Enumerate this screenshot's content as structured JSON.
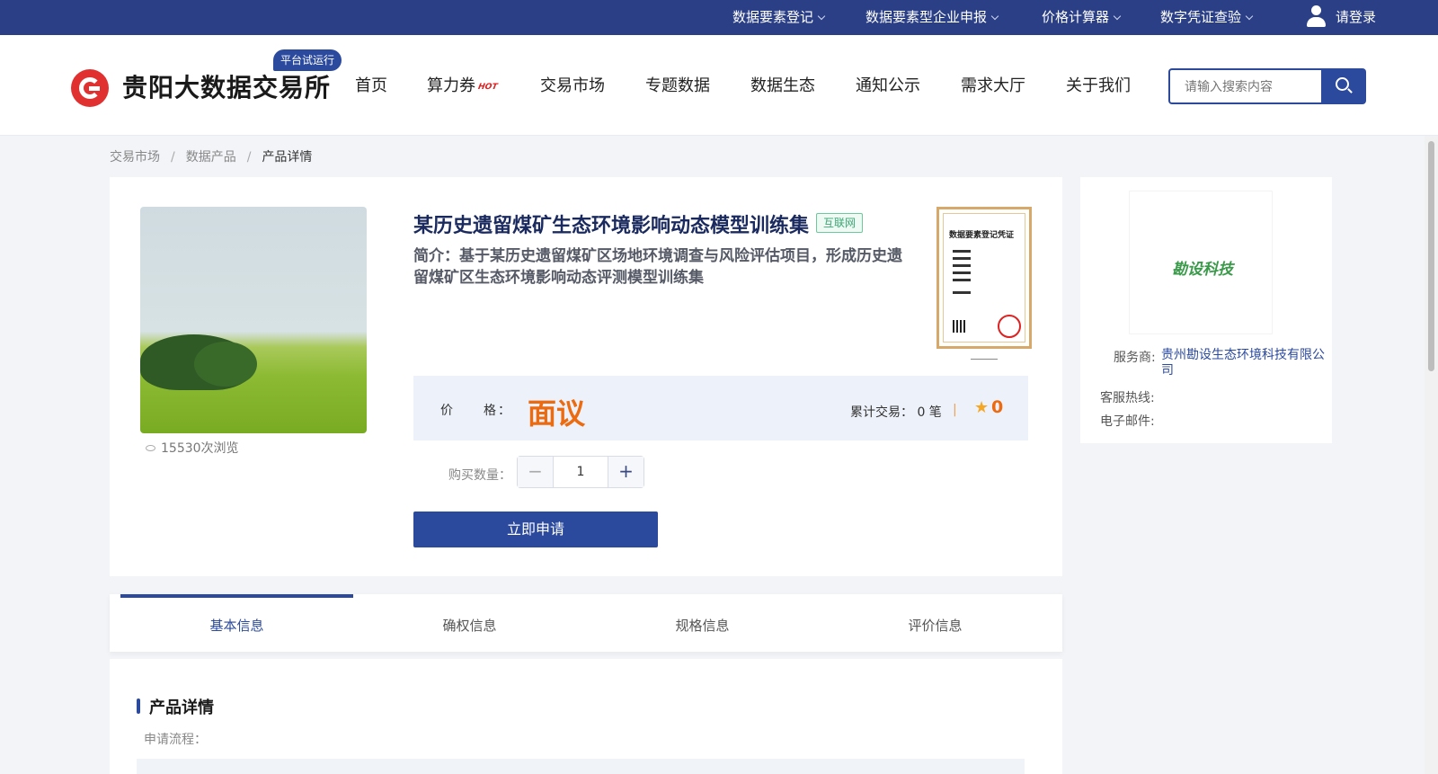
{
  "topbar": {
    "items": [
      {
        "label": "数据要素登记"
      },
      {
        "label": "数据要素型企业申报"
      },
      {
        "label": "价格计算器"
      },
      {
        "label": "数字凭证查验"
      }
    ],
    "login_label": "请登录"
  },
  "header": {
    "logo_text": "贵阳大数据交易所",
    "trial_badge": "平台试运行",
    "nav": [
      "首页",
      "算力券",
      "交易市场",
      "专题数据",
      "数据生态",
      "通知公示",
      "需求大厅",
      "关于我们"
    ],
    "hot_badge": "HOT",
    "search_placeholder": "请输入搜索内容"
  },
  "breadcrumb": {
    "items": [
      "交易市场",
      "数据产品"
    ],
    "current": "产品详情",
    "separator": "/"
  },
  "product": {
    "title": "某历史遗留煤矿生态环境影响动态模型训练集",
    "tag": "互联网",
    "intro": "简介：基于某历史遗留煤矿区场地环境调查与风险评估项目，形成历史遗留煤矿区生态环境影响动态评测模型训练集",
    "views": "15530次浏览",
    "certificate_title": "数据要素登记凭证",
    "price_label": "价　　格：",
    "price_value": "面议",
    "trade_text": "累计交易：  0 笔",
    "trade_separator": "|",
    "rating": "0",
    "qty_label": "购买数量：",
    "qty_value": "1",
    "apply_label": "立即申请"
  },
  "provider": {
    "logo_text": "勘设科技",
    "rows": [
      {
        "label": "服务商:",
        "value": "贵州勘设生态环境科技有限公司"
      },
      {
        "label": "客服热线:",
        "value": ""
      },
      {
        "label": "电子邮件:",
        "value": ""
      }
    ]
  },
  "tabs": [
    "基本信息",
    "确权信息",
    "规格信息",
    "评价信息"
  ],
  "detail": {
    "section_title": "产品详情",
    "flow_label": "申请流程："
  },
  "colors": {
    "primary": "#2b4a9e",
    "topbar": "#2b3f86",
    "price": "#ec6a10",
    "tag_green": "#3aa874"
  }
}
